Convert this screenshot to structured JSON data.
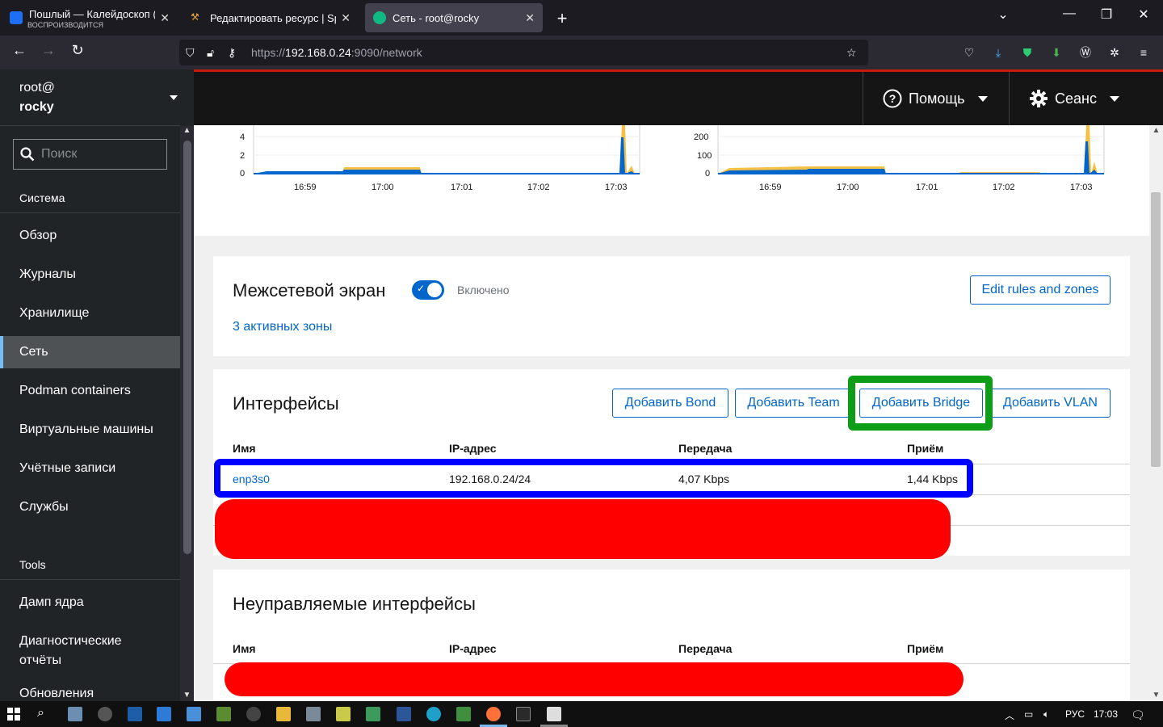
{
  "browser": {
    "tabs": [
      {
        "title": "Пошлый — Калейдоскоп (Кали",
        "subtitle": "ВОСПРОИЗВОДИТСЯ"
      },
      {
        "title": "Редактировать ресурс | SpigotM"
      },
      {
        "title": "Сеть - root@rocky"
      }
    ],
    "url_scheme": "https://",
    "url_host": "192.168.0.24",
    "url_rest": ":9090/network"
  },
  "masthead": {
    "help_label": "Помощь",
    "session_label": "Сеанс"
  },
  "sidebar": {
    "host_user": "root@",
    "host_name": "rocky",
    "search_placeholder": "Поиск",
    "system_title": "Система",
    "items": [
      {
        "label": "Обзор"
      },
      {
        "label": "Журналы"
      },
      {
        "label": "Хранилище"
      },
      {
        "label": "Сеть"
      },
      {
        "label": "Podman containers"
      },
      {
        "label": "Виртуальные машины"
      },
      {
        "label": "Учётные записи"
      },
      {
        "label": "Службы"
      }
    ],
    "tools_title": "Tools",
    "tools_items": [
      {
        "label": "Дамп ядра"
      },
      {
        "label": "Диагностические отчёты"
      },
      {
        "label": "Обновления"
      }
    ]
  },
  "charts": {
    "left": {
      "y_ticks": [
        "4",
        "2",
        "0"
      ],
      "x_ticks": [
        "16:59",
        "17:00",
        "17:01",
        "17:02",
        "17:03"
      ]
    },
    "right": {
      "y_ticks": [
        "200",
        "100",
        "0"
      ],
      "x_ticks": [
        "16:59",
        "17:00",
        "17:01",
        "17:02",
        "17:03"
      ]
    }
  },
  "firewall": {
    "title": "Межсетевой экран",
    "status": "Включено",
    "zones_link": "3 активных зоны",
    "edit_button": "Edit rules and zones"
  },
  "interfaces": {
    "title": "Интерфейсы",
    "buttons": [
      "Добавить Bond",
      "Добавить Team",
      "Добавить Bridge",
      "Добавить VLAN"
    ],
    "columns": [
      "Имя",
      "IP-адрес",
      "Передача",
      "Приём"
    ],
    "rows": [
      {
        "name": "enp3s0",
        "ip": "192.168.0.24/24",
        "tx": "4,07 Kbps",
        "rx": "1,44 Kbps"
      }
    ]
  },
  "unmanaged": {
    "title": "Неуправляемые интерфейсы",
    "columns": [
      "Имя",
      "IP-адрес",
      "Передача",
      "Приём"
    ]
  },
  "taskbar": {
    "lang": "РУС",
    "time": "17:03"
  },
  "colors": {
    "accent": "#0066cc",
    "highlight_green": "#0d9d16",
    "highlight_blue": "#0000ff",
    "redaction": "#ff0000",
    "chart_tx": "#0066cc",
    "chart_rx": "#f4c145"
  }
}
